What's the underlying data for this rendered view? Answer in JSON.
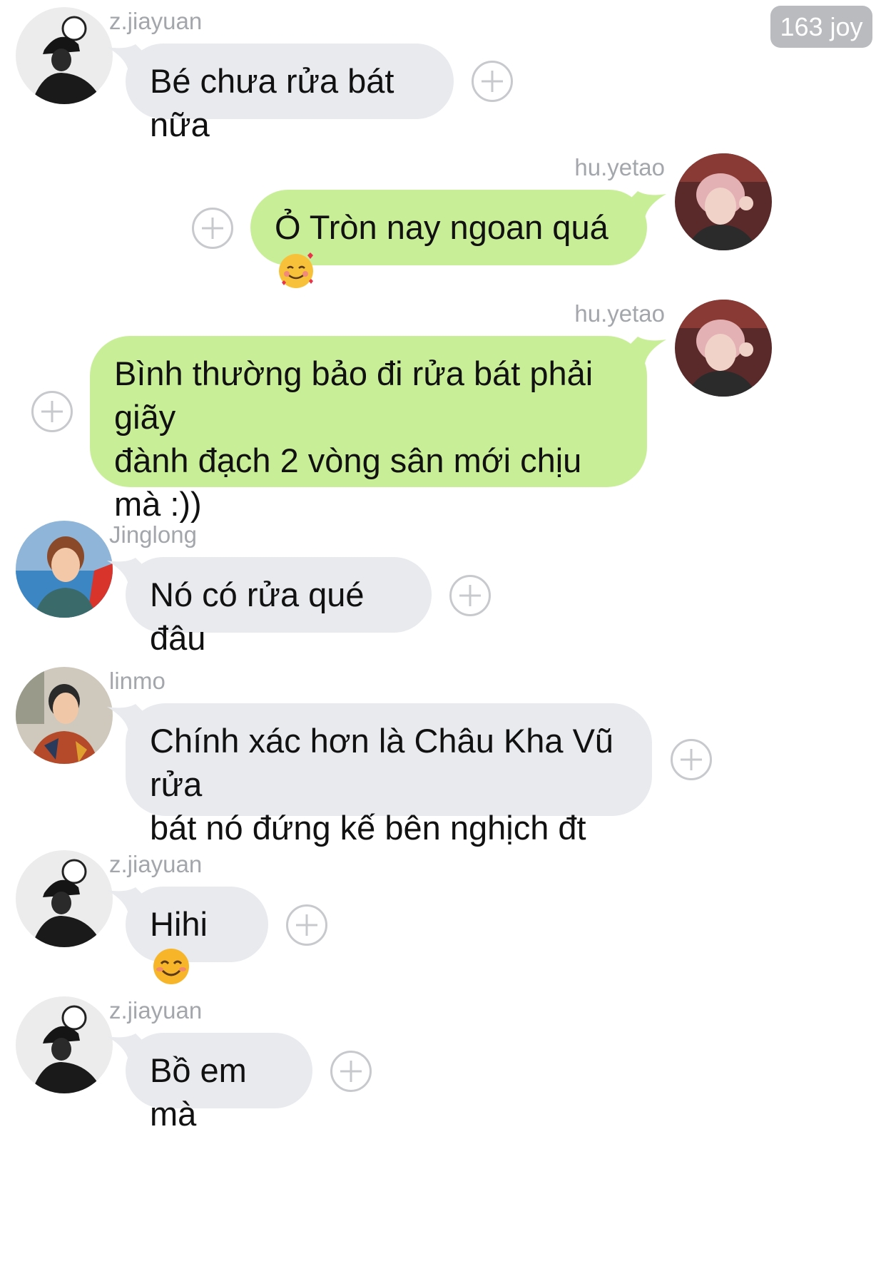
{
  "reaction_badge": "163 joy",
  "messages": [
    {
      "sender": "z.jiayuan",
      "side": "left",
      "text": "Bé chưa rửa bát nữa"
    },
    {
      "sender": "hu.yetao",
      "side": "right",
      "text": "Ỏ Tròn nay ngoan quá",
      "emoji": "smiling-face-with-hearts"
    },
    {
      "sender": "hu.yetao",
      "side": "right",
      "line1": "Bình thường bảo đi rửa bát phải giãy",
      "line2": "đành đạch 2 vòng sân mới chịu",
      "line3": "mà :))"
    },
    {
      "sender": "Jinglong",
      "side": "left",
      "text": "Nó có rửa qué đâu"
    },
    {
      "sender": "linmo",
      "side": "left",
      "line1": "Chính xác hơn là Châu Kha Vũ rửa",
      "line2": "bát nó đứng kế bên nghịch đt"
    },
    {
      "sender": "z.jiayuan",
      "side": "left",
      "text": "Hihi",
      "emoji": "smiling-face-with-smiling-eyes"
    },
    {
      "sender": "z.jiayuan",
      "side": "left",
      "text": "Bồ em mà"
    }
  ],
  "icons": {
    "add_reaction": "plus-circle-icon"
  },
  "colors": {
    "incoming_bubble": "#e8eaee",
    "outgoing_bubble": "#c9ee98",
    "sender_name": "#a3a6aa",
    "badge": "#b9bbbe"
  }
}
